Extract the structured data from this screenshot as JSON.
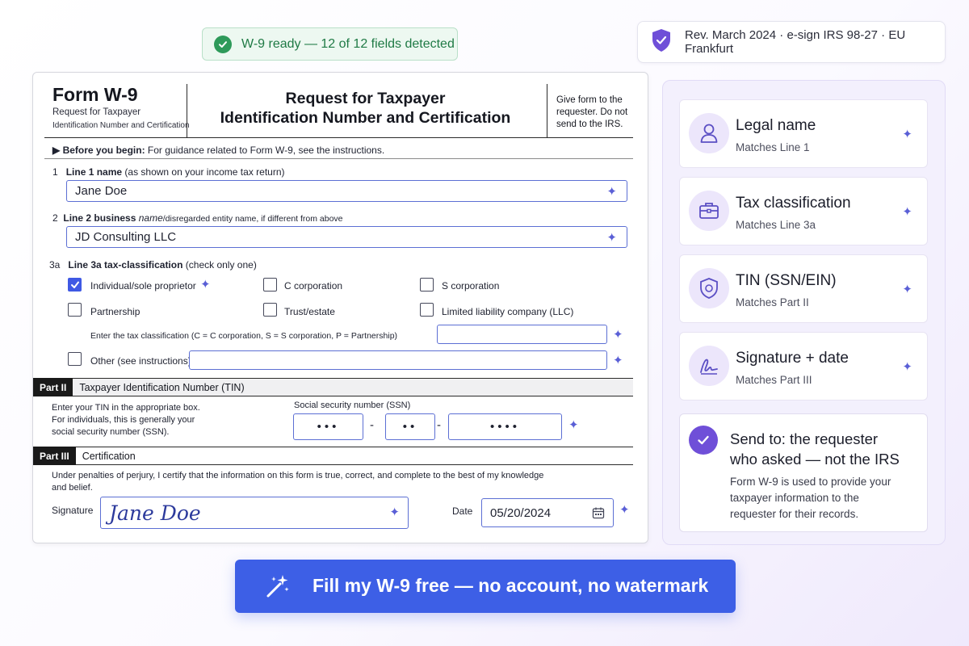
{
  "banner": {
    "status": "W-9 ready — 12 of 12 fields detected"
  },
  "meta": {
    "revision": "Rev. March 2024 · e-sign IRS 98-27 · EU Frankfurt"
  },
  "form": {
    "name": "Form W-9",
    "subtitle_line1": "Request for Taxpayer",
    "subtitle_line2": "Identification Number and Certification",
    "title_line1": "Request for Taxpayer",
    "title_line2": "Identification Number and Certification",
    "give_line1": "Give form to the",
    "give_line2": "requester. Do not",
    "give_line3": "send to the IRS.",
    "before_bold": "▶ Before you begin:",
    "before_text": "For guidance related to Form W-9, see the instructions.",
    "line1": {
      "num": "1",
      "label_bold": "Line 1 name",
      "label_rest": "(as shown on your income tax return)",
      "value": "Jane Doe"
    },
    "line2": {
      "num": "2",
      "label_bold": "Line 2 business ",
      "label_italic": "name",
      "label_rest": "/disregarded entity name, if different from above",
      "value": "JD Consulting LLC"
    },
    "line3": {
      "num": "3a",
      "label_bold": "Line 3a tax-classification",
      "label_rest": "(check only one)",
      "options": [
        {
          "label": "Individual/sole proprietor",
          "checked": true
        },
        {
          "label": "C corporation",
          "checked": false
        },
        {
          "label": "S corporation",
          "checked": false
        },
        {
          "label": "Partnership",
          "checked": false
        },
        {
          "label": "Trust/estate",
          "checked": false
        },
        {
          "label": "Limited liability company (LLC)",
          "checked": false
        },
        {
          "label": "Other (see instructions)",
          "checked": false
        }
      ],
      "llc_hint": "Enter the tax classification (C = C corporation, S = S corporation, P = Partnership)"
    },
    "part2": {
      "tag": "Part II",
      "title": "Taxpayer Identification Number (TIN)",
      "desc_line1": "Enter your TIN in the appropriate box.",
      "desc_line2": "For individuals, this is generally your",
      "desc_line3": "social security number (SSN).",
      "ssn_label": "Social security number (SSN)",
      "ssn1": "•••",
      "dash1": "-",
      "ssn2": "••",
      "dash2": "-",
      "ssn3": "••••"
    },
    "part3": {
      "tag": "Part III",
      "title": "Certification",
      "text_line1": "Under penalties of perjury, I certify that the information on this form is true, correct, and complete to the best of my knowledge",
      "text_line2": "and belief.",
      "signature_label": "Signature",
      "signature_value": "Jane Doe",
      "date_label": "Date",
      "date_value": "05/20/2024"
    }
  },
  "checks": [
    {
      "title": "Legal name",
      "subtitle": "Matches Line 1",
      "icon": "person-icon"
    },
    {
      "title": "Tax classification",
      "subtitle": "Matches Line 3a",
      "icon": "briefcase-icon"
    },
    {
      "title": "TIN (SSN/EIN)",
      "subtitle": "Matches Part II",
      "icon": "shield-lock-icon"
    },
    {
      "title": "Signature + date",
      "subtitle": "Matches Part III",
      "icon": "signature-icon"
    }
  ],
  "send": {
    "title_line1": "Send to: the requester",
    "title_line2": "who asked — not the IRS",
    "body_line1": "Form W-9 is used to provide your",
    "body_line2": "taxpayer information to the",
    "body_line3": "requester for their records."
  },
  "cta": {
    "label": "Fill my W-9 free — no account, no watermark"
  },
  "colors": {
    "accent": "#3d5fe6",
    "purple": "#6f4fd8",
    "green": "#2e9a5a",
    "field_border": "#5c6fd4"
  }
}
